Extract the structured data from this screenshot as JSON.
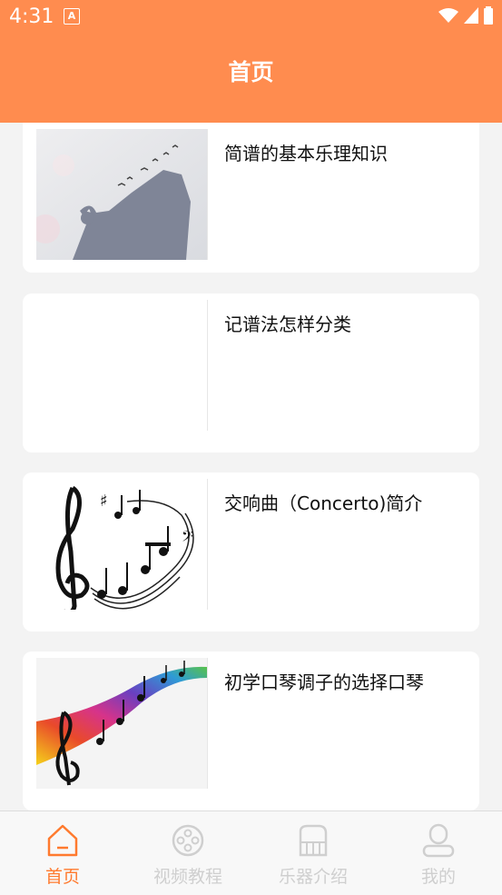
{
  "status_bar": {
    "time": "4:31",
    "notification_letter": "A"
  },
  "header": {
    "title": "首页"
  },
  "articles": [
    {
      "title": "简谱的基本乐理知识"
    },
    {
      "title": "记谱法怎样分类"
    },
    {
      "title": "交响曲（Concerto)简介"
    },
    {
      "title": "初学口琴调子的选择口琴"
    }
  ],
  "tabs": [
    {
      "label": "首页",
      "icon": "home-icon",
      "active": true
    },
    {
      "label": "视频教程",
      "icon": "film-reel-icon",
      "active": false
    },
    {
      "label": "乐器介绍",
      "icon": "piano-icon",
      "active": false
    },
    {
      "label": "我的",
      "icon": "user-icon",
      "active": false
    }
  ],
  "colors": {
    "accent": "#ff8c4f",
    "active_tab": "#ff7a2e",
    "inactive_tab": "#cfcfcf"
  }
}
